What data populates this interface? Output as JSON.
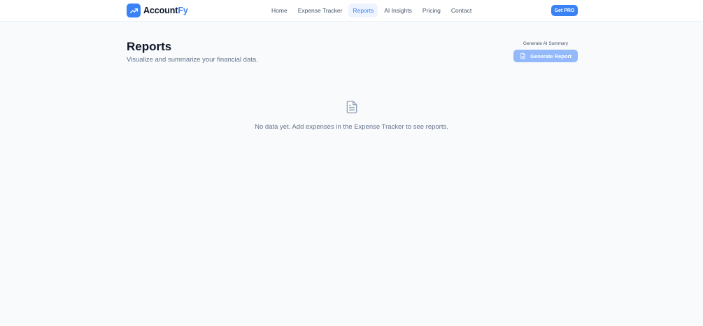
{
  "brand": {
    "name_main": "Account",
    "name_accent": "Fy",
    "icon": "trending-up-icon"
  },
  "nav": {
    "items": [
      {
        "label": "Home"
      },
      {
        "label": "Expense Tracker"
      },
      {
        "label": "Reports",
        "active": true
      },
      {
        "label": "AI Insights"
      },
      {
        "label": "Pricing"
      },
      {
        "label": "Contact"
      }
    ],
    "cta_label": "Get PRO"
  },
  "page": {
    "title": "Reports",
    "subtitle": "Visualize and summarize your financial data."
  },
  "ai_summary": {
    "label": "Generate AI Summary",
    "button_label": "Generate Report",
    "button_icon": "file-text-icon"
  },
  "empty_state": {
    "icon": "file-text-icon",
    "message": "No data yet. Add expenses in the Expense Tracker to see reports."
  },
  "colors": {
    "primary": "#3b82f6",
    "primary_disabled": "#93b9fb",
    "background": "#f8fafc",
    "text_muted": "#64748b"
  }
}
